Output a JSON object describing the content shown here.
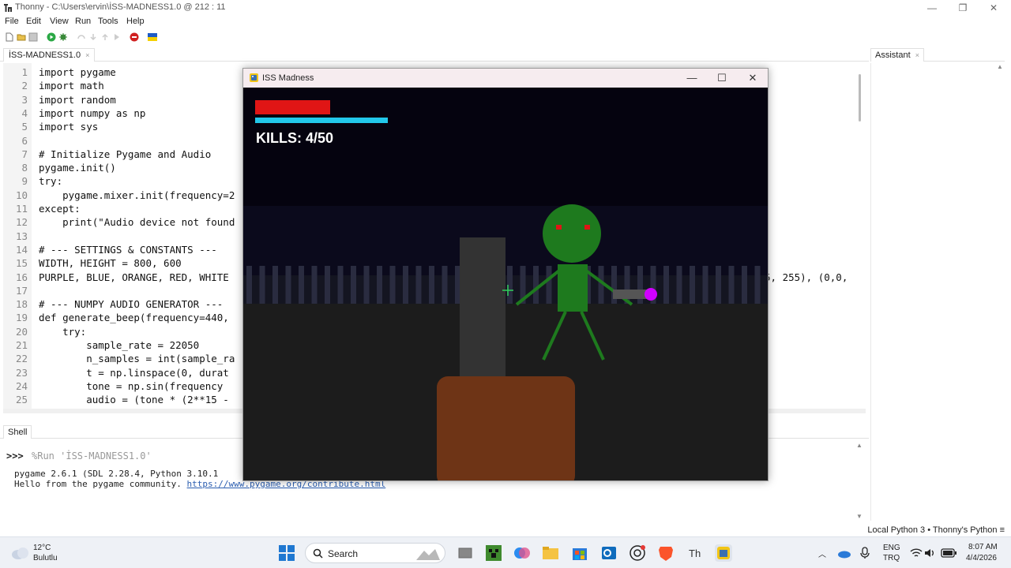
{
  "window": {
    "app_name": "Thonny",
    "path": "C:\\Users\\ervin\\İSS-MADNESS1.0",
    "cursor_pos": "@  212 : 11",
    "controls": [
      "—",
      "❐",
      "✕"
    ]
  },
  "menu": [
    "File",
    "Edit",
    "View",
    "Run",
    "Tools",
    "Help"
  ],
  "toolbar": [
    "new-file",
    "open-file",
    "save-file",
    "run",
    "debug",
    "step-over",
    "step-into",
    "step-out",
    "resume",
    "stop",
    "flag"
  ],
  "editor": {
    "tab_label": "İSS-MADNESS1.0",
    "tab_close": "×",
    "lines": [
      {
        "n": "1",
        "code": "import pygame"
      },
      {
        "n": "2",
        "code": "import math"
      },
      {
        "n": "3",
        "code": "import random"
      },
      {
        "n": "4",
        "code": "import numpy as np"
      },
      {
        "n": "5",
        "code": "import sys"
      },
      {
        "n": "6",
        "code": ""
      },
      {
        "n": "7",
        "code": "# Initialize Pygame and Audio"
      },
      {
        "n": "8",
        "code": "pygame.init()"
      },
      {
        "n": "9",
        "code": "try:"
      },
      {
        "n": "10",
        "code": "    pygame.mixer.init(frequency=2"
      },
      {
        "n": "11",
        "code": "except:"
      },
      {
        "n": "12",
        "code": "    print(\"Audio device not found"
      },
      {
        "n": "13",
        "code": ""
      },
      {
        "n": "14",
        "code": "# --- SETTINGS & CONSTANTS ---"
      },
      {
        "n": "15",
        "code": "WIDTH, HEIGHT = 800, 600"
      },
      {
        "n": "16",
        "code": "PURPLE, BLUE, ORANGE, RED, WHITE"
      },
      {
        "n": "17",
        "code": ""
      },
      {
        "n": "18",
        "code": "# --- NUMPY AUDIO GENERATOR ---"
      },
      {
        "n": "19",
        "code": "def generate_beep(frequency=440,"
      },
      {
        "n": "20",
        "code": "    try:"
      },
      {
        "n": "21",
        "code": "        sample_rate = 22050"
      },
      {
        "n": "22",
        "code": "        n_samples = int(sample_ra"
      },
      {
        "n": "23",
        "code": "        t = np.linspace(0, durat"
      },
      {
        "n": "24",
        "code": "        tone = np.sin(frequency"
      },
      {
        "n": "25",
        "code": "        audio = (tone * (2**15 -"
      }
    ],
    "line16_tail": "5, 255), (0,0,"
  },
  "assistant": {
    "tab_label": "Assistant",
    "tab_close": "×"
  },
  "shell": {
    "tab_label": "Shell",
    "prompt": ">>>",
    "command": "%Run 'İSS-MADNESS1.0'",
    "output1": "pygame 2.6.1 (SDL 2.28.4, Python 3.10.1",
    "output2_prefix": "Hello from the pygame community. ",
    "output2_link": "https://www.pygame.org/contribute.html"
  },
  "statusbar": {
    "text": "Local Python 3  •  Thonny's Python  ≡"
  },
  "game": {
    "window_title": "ISS Madness",
    "kills_text": "KILLS: 4/50",
    "health_fraction": 1.0,
    "ammo_fraction": 1.0,
    "colors": {
      "sky": "#05030f",
      "ground": "#1c1c1c",
      "fence": "#2a2c40",
      "alien": "#1e7a1e",
      "alien_eyes": "#e01515",
      "health": "#e01515",
      "ammo": "#22c8ea",
      "pillar": "#333333",
      "player_gun": "#6e3416",
      "alien_gun_tip": "#d000ff"
    }
  },
  "taskbar": {
    "weather_temp": "12°C",
    "weather_desc": "Bulutlu",
    "search_label": "Search",
    "lang1": "ENG",
    "lang2": "TRQ",
    "time": "8:07 AM",
    "date": "4/4/2026"
  }
}
